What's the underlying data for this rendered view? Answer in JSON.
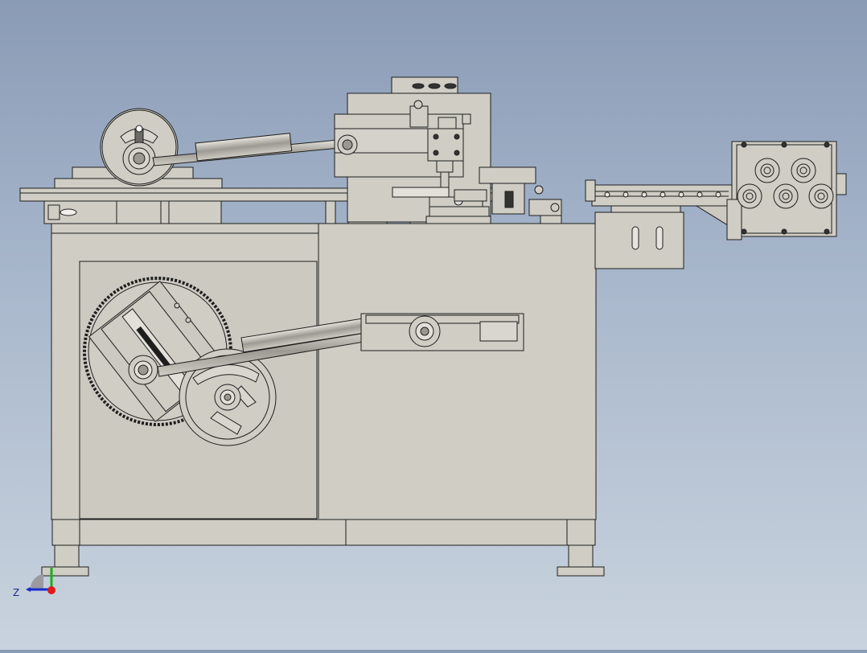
{
  "viewport": {
    "background_top": "#8a9bb6",
    "background_bottom": "#c9d3de",
    "part_fill": "#cfcdc4",
    "part_stroke": "#1e1e1e"
  },
  "triad": {
    "axis_z_label": "Z",
    "axis_colors": {
      "x": "#e01a1a",
      "y": "#18b018",
      "z": "#1a2ad0"
    }
  }
}
